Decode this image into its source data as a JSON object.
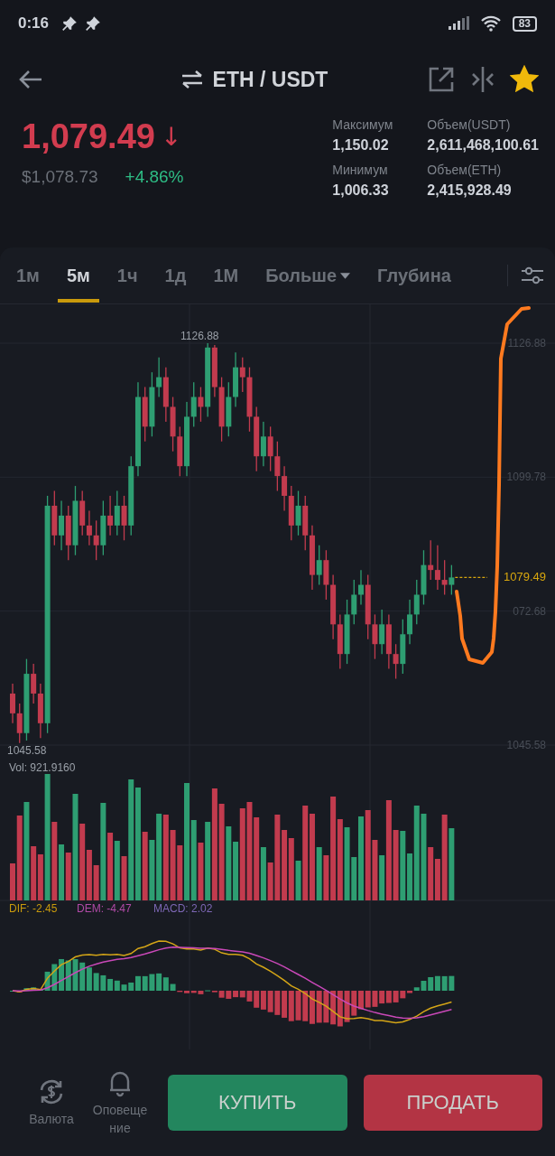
{
  "status_bar": {
    "time": "0:16",
    "battery": "83"
  },
  "header": {
    "pair": "ETH / USDT",
    "favorite": true
  },
  "ticker": {
    "price": "1,079.49",
    "direction": "↓",
    "usd_price": "$1,078.73",
    "change": "+4.86%",
    "stats": [
      {
        "label": "Максимум",
        "value": "1,150.02"
      },
      {
        "label": "Объем(USDT)",
        "value": "2,611,468,100.61"
      },
      {
        "label": "Минимум",
        "value": "1,006.33"
      },
      {
        "label": "Объем(ETH)",
        "value": "2,415,928.49"
      }
    ]
  },
  "intervals": [
    {
      "label": "1м",
      "kind": "tab",
      "selected": false
    },
    {
      "label": "5м",
      "kind": "tab",
      "selected": true
    },
    {
      "label": "1ч",
      "kind": "tab",
      "selected": false
    },
    {
      "label": "1д",
      "kind": "tab",
      "selected": false
    },
    {
      "label": "1M",
      "kind": "tab",
      "selected": false
    },
    {
      "label": "Больше",
      "kind": "dropdown",
      "selected": false
    },
    {
      "label": "Глубина",
      "kind": "tab",
      "selected": false
    }
  ],
  "chart": {
    "chart_data": {
      "type": "candlestick",
      "ylim": [
        1045.58,
        1126.88
      ],
      "yticks": [
        {
          "value": 1045.58,
          "label": "1045.58"
        },
        {
          "value": 1099.78,
          "label": "1099.78"
        },
        {
          "value": 1126.88,
          "label": "1126.88"
        }
      ],
      "ohlc": [
        [
          1056,
          1058,
          1050,
          1052
        ],
        [
          1052,
          1054,
          1046,
          1048
        ],
        [
          1048,
          1063,
          1046.5,
          1060
        ],
        [
          1060,
          1062,
          1054,
          1056
        ],
        [
          1056,
          1058,
          1047,
          1050
        ],
        [
          1050,
          1096,
          1048,
          1094
        ],
        [
          1094,
          1097,
          1086,
          1088
        ],
        [
          1088,
          1095,
          1085,
          1092
        ],
        [
          1092,
          1094,
          1083,
          1086
        ],
        [
          1086,
          1098,
          1084,
          1095
        ],
        [
          1095,
          1097,
          1088,
          1090
        ],
        [
          1090,
          1093,
          1086,
          1088
        ],
        [
          1088,
          1091,
          1083,
          1086
        ],
        [
          1086,
          1095,
          1084,
          1092
        ],
        [
          1092,
          1096,
          1088,
          1090
        ],
        [
          1090,
          1097,
          1088,
          1094
        ],
        [
          1094,
          1096,
          1087,
          1090
        ],
        [
          1090,
          1104,
          1088,
          1102
        ],
        [
          1102,
          1119,
          1100,
          1116
        ],
        [
          1116,
          1118,
          1107,
          1110
        ],
        [
          1110,
          1121,
          1108,
          1118
        ],
        [
          1118,
          1124,
          1116,
          1120
        ],
        [
          1120,
          1122,
          1111,
          1114
        ],
        [
          1114,
          1116,
          1105,
          1108
        ],
        [
          1108,
          1110,
          1100,
          1102
        ],
        [
          1102,
          1115,
          1100,
          1112
        ],
        [
          1112,
          1119,
          1110,
          1116
        ],
        [
          1116,
          1118,
          1111,
          1114
        ],
        [
          1114,
          1126.88,
          1112,
          1126
        ],
        [
          1126,
          1126.5,
          1116,
          1118
        ],
        [
          1118,
          1120,
          1107,
          1110
        ],
        [
          1110,
          1119,
          1108,
          1116
        ],
        [
          1116,
          1125,
          1114,
          1122
        ],
        [
          1122,
          1124,
          1117,
          1120
        ],
        [
          1120,
          1122,
          1109,
          1112
        ],
        [
          1112,
          1114,
          1101,
          1104
        ],
        [
          1104,
          1111,
          1102,
          1108
        ],
        [
          1108,
          1110,
          1101,
          1104
        ],
        [
          1104,
          1107,
          1097,
          1100
        ],
        [
          1100,
          1102,
          1093,
          1096
        ],
        [
          1096,
          1098,
          1087,
          1090
        ],
        [
          1090,
          1097,
          1088,
          1094
        ],
        [
          1094,
          1096,
          1085,
          1088
        ],
        [
          1088,
          1090,
          1077,
          1080
        ],
        [
          1080,
          1086,
          1078,
          1083
        ],
        [
          1083,
          1085,
          1075,
          1078
        ],
        [
          1078,
          1080,
          1067,
          1070
        ],
        [
          1070,
          1072,
          1061,
          1064
        ],
        [
          1064,
          1075,
          1062,
          1072
        ],
        [
          1072,
          1079,
          1070,
          1076
        ],
        [
          1076,
          1081,
          1074,
          1078
        ],
        [
          1078,
          1080,
          1067,
          1070
        ],
        [
          1070,
          1072,
          1063,
          1066
        ],
        [
          1066,
          1073,
          1064,
          1070
        ],
        [
          1070,
          1072,
          1061,
          1064
        ],
        [
          1064,
          1066,
          1059,
          1062
        ],
        [
          1062,
          1071,
          1060,
          1068
        ],
        [
          1068,
          1075,
          1066,
          1072
        ],
        [
          1072,
          1079,
          1070,
          1076
        ],
        [
          1076,
          1085,
          1074,
          1082
        ],
        [
          1082,
          1087,
          1079,
          1081
        ],
        [
          1081,
          1086,
          1077,
          1079
        ],
        [
          1079,
          1083,
          1076,
          1078
        ],
        [
          1078,
          1082,
          1076,
          1079.49
        ]
      ]
    },
    "partial_axis_label": "072.68",
    "high_label": "1126.88",
    "low_label": "1045.58",
    "last_price": "1079.49",
    "volume": "Vol: 921.9160",
    "macd": [
      "DIF: -2.45",
      "DEM: -4.47",
      "MACD: 2.02"
    ]
  },
  "bottom_bar": {
    "actions": [
      {
        "label": "Валюта",
        "kind": "currency"
      },
      {
        "label": "Оповещение",
        "kind": "alert"
      }
    ],
    "buttons": [
      {
        "label": "КУПИТЬ",
        "kind": "buy"
      },
      {
        "label": "ПРОДАТЬ",
        "kind": "sell"
      }
    ]
  }
}
